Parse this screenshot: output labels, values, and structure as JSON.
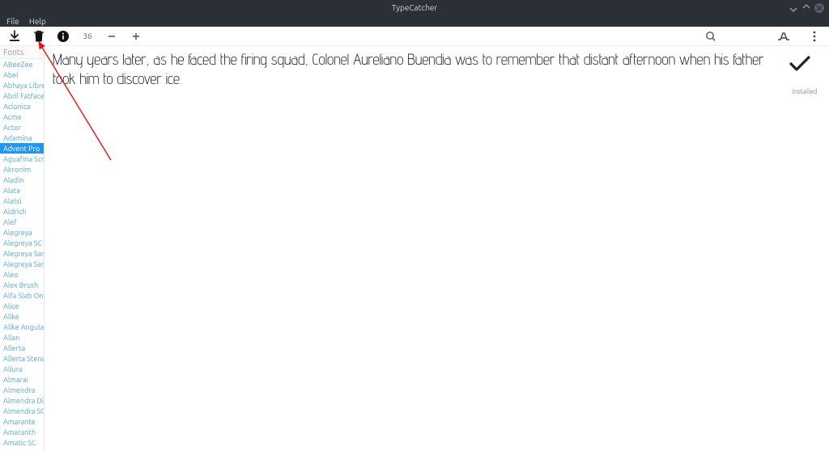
{
  "window": {
    "title": "TypeCatcher"
  },
  "menu": {
    "file": "File",
    "help": "Help"
  },
  "toolbar": {
    "font_size": "36",
    "minus": "−",
    "plus": "+"
  },
  "sidebar": {
    "header": "Fonts",
    "items": [
      "ABeeZee",
      "Abel",
      "Abhaya Libre",
      "Abril Fatface",
      "Aclonica",
      "Acme",
      "Actor",
      "Adamina",
      "Advent Pro",
      "Aguafina Script",
      "Akronim",
      "Aladin",
      "Alata",
      "Alatsi",
      "Aldrich",
      "Alef",
      "Alegreya",
      "Alegreya SC",
      "Alegreya Sans",
      "Alegreya Sans SC",
      "Aleo",
      "Alex Brush",
      "Alfa Slab One",
      "Alice",
      "Alike",
      "Alike Angular",
      "Allan",
      "Allerta",
      "Allerta Stencil",
      "Allura",
      "Almarai",
      "Almendra",
      "Almendra Display",
      "Almendra SC",
      "Amarante",
      "Amaranth",
      "Amatic SC"
    ],
    "selected_index": 8
  },
  "preview": {
    "sample_text": "Many years later, as he faced the firing squad, Colonel Aureliano Buendia was to remember that distant afternoon when his father took him to discover ice."
  },
  "status": {
    "label": "Installed"
  },
  "icons": {
    "download": "download-icon",
    "trash": "trash-icon",
    "info": "info-icon",
    "search": "search-icon",
    "report": "report-icon",
    "menu": "menu-icon"
  }
}
